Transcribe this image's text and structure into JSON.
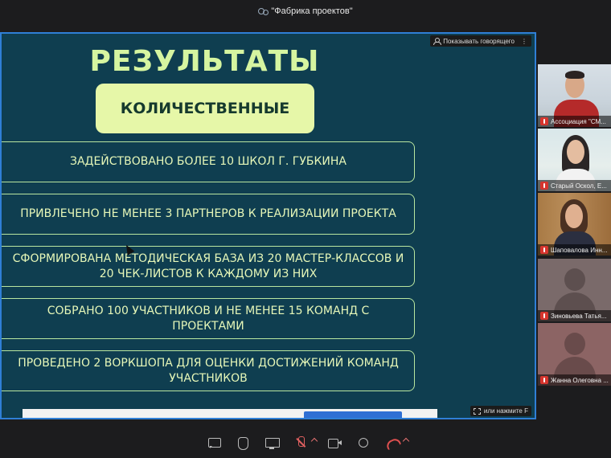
{
  "window": {
    "title": "\"Фабрика проектов\""
  },
  "screen_share": {
    "show_speaker_label": "Показывать говорящего",
    "fullscreen_hint": "или нажмите F"
  },
  "slide": {
    "title": "РЕЗУЛЬТАТЫ",
    "subtitle": "КОЛИЧЕСТВЕННЫЕ",
    "items": [
      "ЗАДЕЙСТВОВАНО БОЛЕЕ 10 ШКОЛ Г. ГУБКИНА",
      "ПРИВЛЕЧЕНО НЕ МЕНЕЕ 3 ПАРТНЕРОВ К РЕАЛИЗАЦИИ ПРОЕКТА",
      "СФОРМИРОВАНА МЕТОДИЧЕСКАЯ БАЗА ИЗ 20 МАСТЕР-КЛАССОВ И 20 ЧЕК-ЛИСТОВ К КАЖДОМУ ИЗ НИХ",
      "СОБРАНО 100 УЧАСТНИКОВ И НЕ МЕНЕЕ 15 КОМАНД С ПРОЕКТАМИ",
      "ПРОВЕДЕНО 2 ВОРКШОПА ДЛЯ ОЦЕНКИ ДОСТИЖЕНИЙ КОМАНД УЧАСТНИКОВ"
    ]
  },
  "participants": [
    {
      "name": "Ассоциация \"СМ...",
      "muted": true
    },
    {
      "name": "Старый Оскол, Е...",
      "muted": true
    },
    {
      "name": "Шаповалова Инн...",
      "muted": true
    },
    {
      "name": "Зиновьева Татья...",
      "muted": true
    },
    {
      "name": "Жанна Олеговна ...",
      "muted": true
    }
  ],
  "toolbar": {
    "icons": [
      "chat-icon",
      "raise-hand-icon",
      "screen-share-icon",
      "microphone-muted-icon",
      "camera-icon",
      "more-icon",
      "hangup-icon"
    ]
  },
  "colors": {
    "slide_background": "#0f3e50",
    "slide_accent": "#e6f7a8",
    "share_border": "#2f7fd6",
    "muted_red": "#d6352e"
  }
}
